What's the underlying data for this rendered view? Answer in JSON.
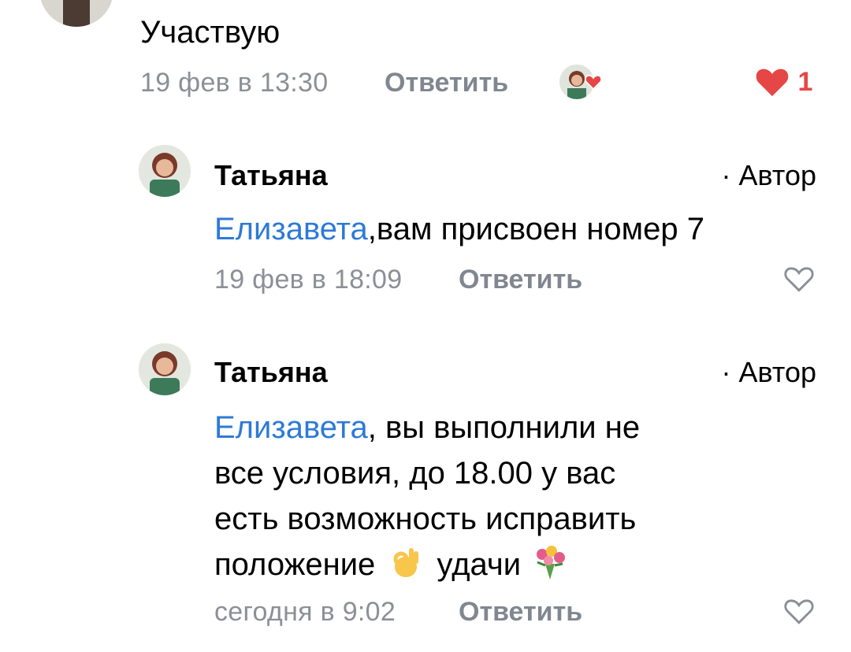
{
  "top_comment": {
    "text": "Участвую",
    "time": "19 фев в 13:30",
    "reply_label": "Ответить",
    "likes": "1"
  },
  "comments": [
    {
      "name": "Татьяна",
      "role": "· Автор",
      "mention": "Елизавета",
      "text": ",вам присвоен номер 7",
      "time": "19 фев в 18:09",
      "reply_label": "Ответить"
    },
    {
      "name": "Татьяна",
      "role": "· Автор",
      "mention": "Елизавета",
      "text_line1": ", вы выполнили не",
      "text_line2": "все условия, до 18.00 у вас",
      "text_line3": "есть возможность исправить",
      "text_line4a": "положение",
      "text_line4b": "удачи",
      "time": "сегодня в 9:02",
      "reply_label": "Ответить"
    }
  ],
  "colors": {
    "accent": "#2d7ad6",
    "like": "#e64646",
    "meta": "#8c8f97"
  },
  "icons": [
    "heart-filled-icon",
    "heart-outline-icon",
    "ok-hand-emoji",
    "bouquet-emoji"
  ]
}
